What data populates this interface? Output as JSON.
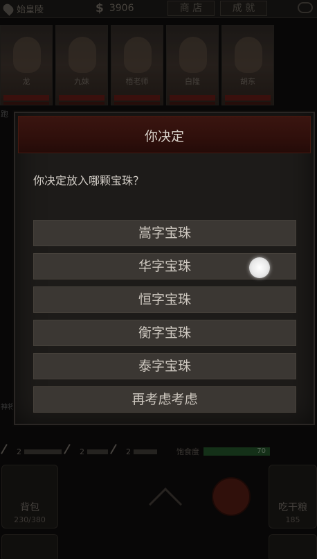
{
  "topbar": {
    "location": "始皇陵",
    "money": "3906",
    "btn_shop": "商 店",
    "btn_achievements": "成 就"
  },
  "team": [
    {
      "name": "龙"
    },
    {
      "name": "九妹"
    },
    {
      "name": "梧老师"
    },
    {
      "name": "白隆"
    },
    {
      "name": "胡东"
    }
  ],
  "side_labels": {
    "left_top": "跑",
    "left_bottom": "神将"
  },
  "stats": {
    "weapons": [
      {
        "count": "2"
      },
      {
        "count": "2"
      },
      {
        "count": "2"
      }
    ],
    "hunger_label": "饱食度",
    "hunger_value": "70"
  },
  "bottom": {
    "bag_label": "背包",
    "bag_count": "230/380",
    "food_label": "吃干粮",
    "food_count": "185"
  },
  "dialog": {
    "title": "你决定",
    "prompt": "你决定放入哪颗宝珠？",
    "options": [
      "嵩字宝珠",
      "华字宝珠",
      "恒字宝珠",
      "衡字宝珠",
      "泰字宝珠",
      "再考虑考虑"
    ]
  }
}
